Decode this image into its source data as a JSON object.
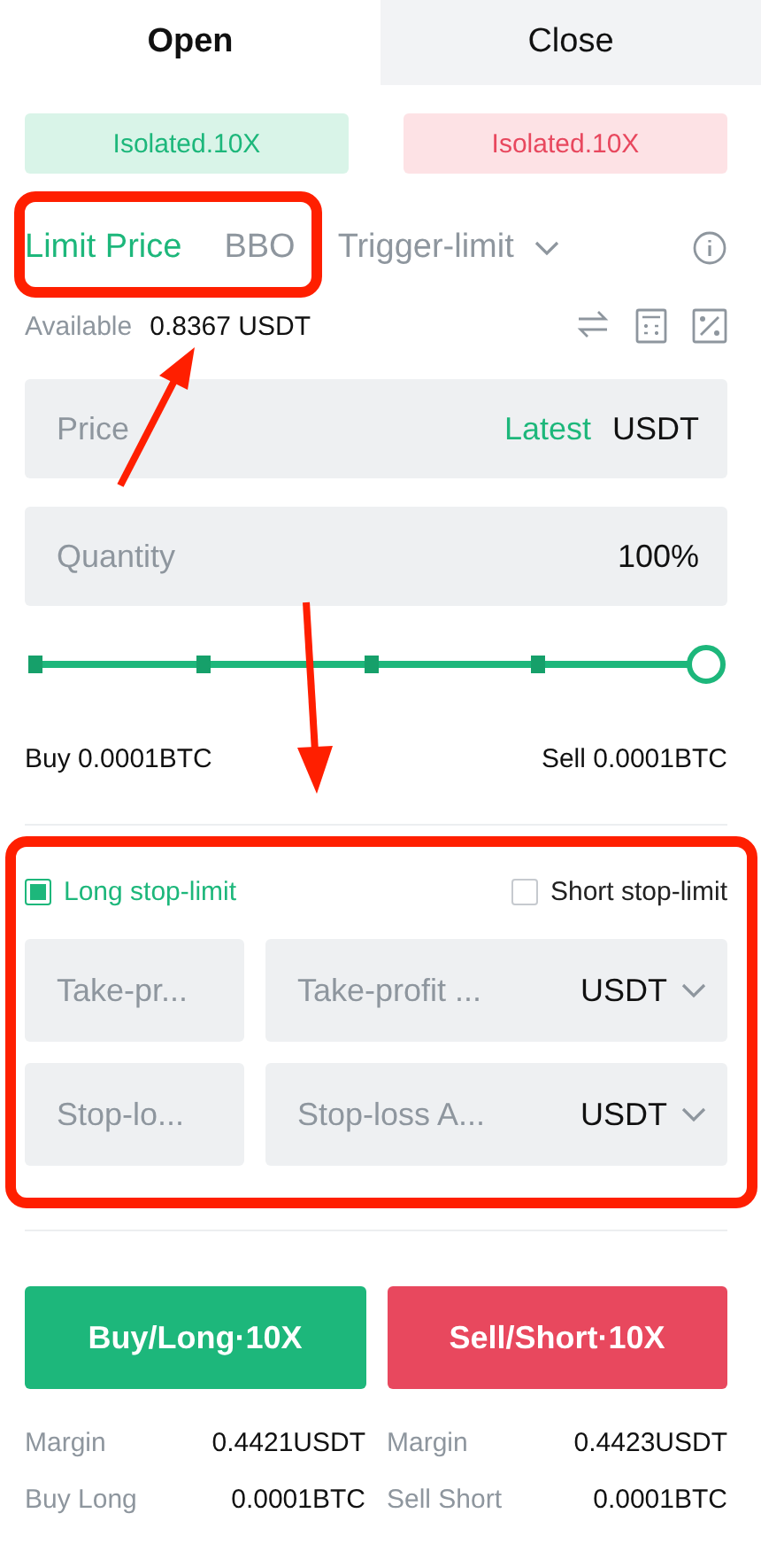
{
  "tabs": [
    {
      "label": "Open",
      "selected": true
    },
    {
      "label": "Close",
      "selected": false
    }
  ],
  "leverage": [
    {
      "label": "Isolated.10X"
    },
    {
      "label": "Isolated.10X"
    }
  ],
  "order_types": [
    {
      "label": "Limit Price",
      "selected": true,
      "kind": "plain"
    },
    {
      "label": "BBO",
      "selected": false,
      "kind": "plain"
    },
    {
      "label": "Trigger-limit",
      "selected": false,
      "kind": "dropdown"
    }
  ],
  "available": {
    "label": "Available",
    "value": "0.8367 USDT"
  },
  "price": {
    "placeholder": "Price",
    "source": "Latest",
    "unit": "USDT"
  },
  "quantity": {
    "placeholder": "Quantity",
    "percent": "100%"
  },
  "slider": {
    "level": 1
  },
  "amounts": {
    "buy": "Buy 0.0001BTC",
    "sell": "Sell 0.0001BTC"
  },
  "stop_options": [
    {
      "label": "Long stop-limit",
      "checked": true
    },
    {
      "label": "Short stop-limit",
      "checked": false
    }
  ],
  "stop_fields": [
    {
      "price_placeholder": "Take-pr...",
      "amount_placeholder": "Take-profit ...",
      "unit": "USDT"
    },
    {
      "price_placeholder": "Stop-lo...",
      "amount_placeholder": "Stop-loss A...",
      "unit": "USDT"
    }
  ],
  "actions": [
    {
      "label": "Buy/Long·10X",
      "rows": [
        {
          "label": "Margin",
          "value": "0.4421USDT"
        },
        {
          "label": "Buy Long",
          "value": "0.0001BTC"
        }
      ]
    },
    {
      "label": "Sell/Short·10X",
      "rows": [
        {
          "label": "Margin",
          "value": "0.4423USDT"
        },
        {
          "label": "Sell Short",
          "value": "0.0001BTC"
        }
      ]
    }
  ]
}
